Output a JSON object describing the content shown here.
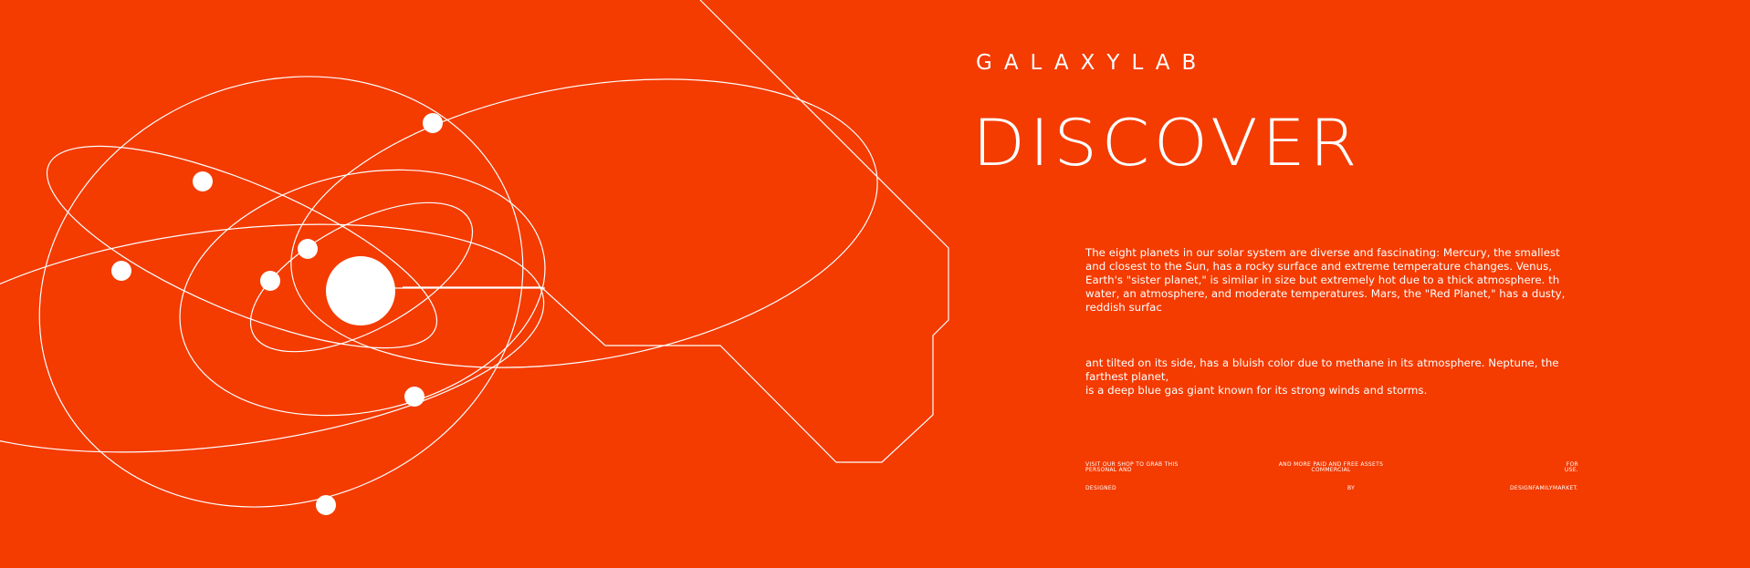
{
  "brand": {
    "name": "GALAXYLAB"
  },
  "hero": {
    "headline": "DISCOVER"
  },
  "body": {
    "paragraph_1": "The eight planets in our solar system are diverse and fascinating: Mercury, the smallest and closest to the Sun, has a rocky surface and extreme temperature changes. Venus, Earth's \"sister planet,\" is similar in size but extremely hot due to a thick atmosphere. th water, an atmosphere, and moderate temperatures. Mars, the \"Red Planet,\" has a dusty, reddish surfac",
    "paragraph_2": "ant tilted on its side, has a bluish color due to methane in its atmosphere. Neptune, the farthest planet,\nis a deep blue gas giant known for its strong winds and storms."
  },
  "footer": {
    "fine_left": "VISIT OUR SHOP TO GRAB THIS\nPERSONAL AND",
    "fine_mid": "AND MORE PAID AND FREE ASSETS\nCOMMERCIAL",
    "fine_right": "FOR\nUSE.",
    "credit_left": "DESIGNED",
    "credit_mid": "BY",
    "credit_right": "DESIGNFAMILYMARKET."
  },
  "colors": {
    "background": "#F43B00",
    "foreground": "#FFFFFF"
  },
  "icons": {
    "illustration": "solar-system-orbit-illustration",
    "sun": "sun-icon",
    "planet": "planet-dot-icon"
  }
}
